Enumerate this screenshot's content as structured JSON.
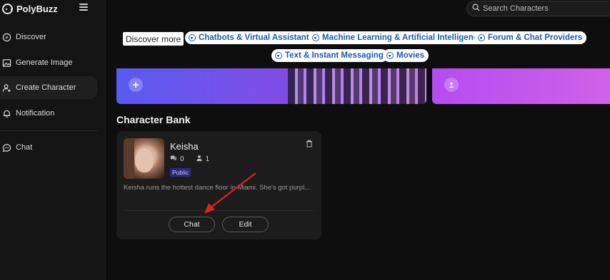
{
  "app": {
    "brand_name": "PolyBuzz"
  },
  "search": {
    "placeholder": "Search Characters"
  },
  "sidebar": {
    "items": [
      {
        "label": "Discover",
        "icon": "compass-icon"
      },
      {
        "label": "Generate Image",
        "icon": "image-icon"
      },
      {
        "label": "Create Character",
        "icon": "user-plus-icon"
      },
      {
        "label": "Notification",
        "icon": "bell-icon"
      },
      {
        "label": "Chat",
        "icon": "chat-bubble-icon"
      }
    ]
  },
  "tags": {
    "discover_more": "Discover more",
    "items": [
      "Chatbots & Virtual Assistants",
      "Machine Learning & Artificial Intelligence",
      "Forum & Chat Providers",
      "Text & Instant Messaging",
      "Movies"
    ]
  },
  "main": {
    "section_title": "Character Bank",
    "character": {
      "name": "Keisha",
      "chats": "0",
      "followers": "1",
      "visibility": "Public",
      "description": "Keisha runs the hottest dance floor in Miami. She's got purpl...",
      "chat_label": "Chat",
      "edit_label": "Edit"
    }
  },
  "colors": {
    "background": "#0e0e0e",
    "sidebar": "#141414",
    "card": "#1c1c1c",
    "tag_text": "#1a5bb8",
    "badge_bg": "#2c2a7a",
    "annotation_arrow": "#e02020"
  }
}
